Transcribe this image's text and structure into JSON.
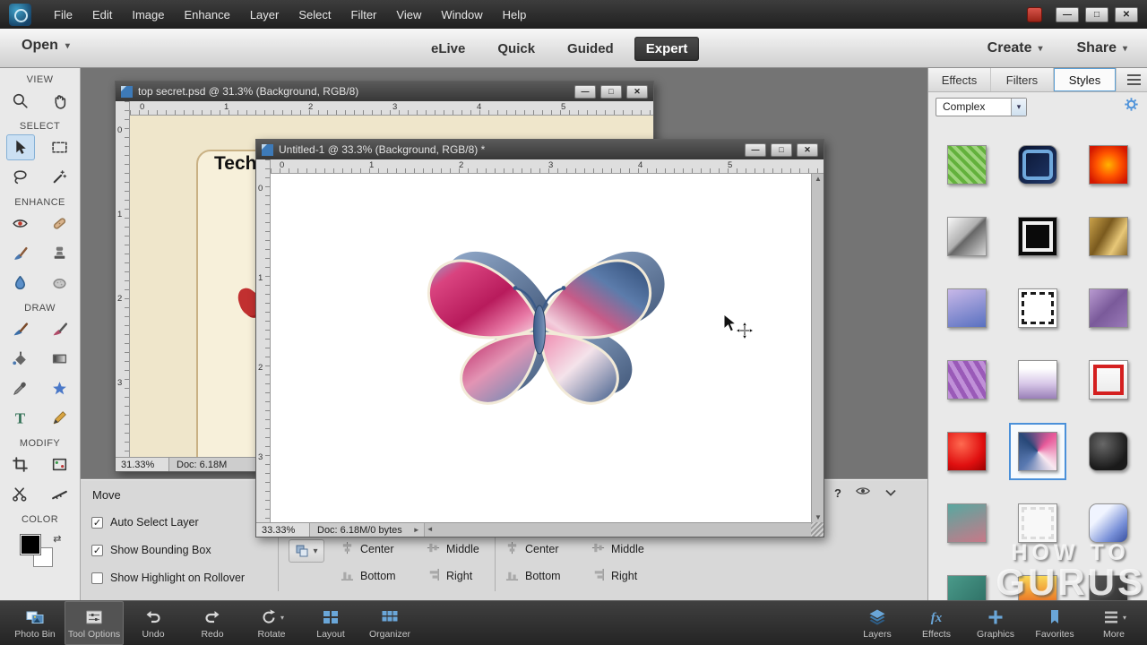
{
  "app": {
    "window_buttons": [
      {
        "name": "minimize",
        "glyph": "—"
      },
      {
        "name": "maximize",
        "glyph": "□"
      },
      {
        "name": "close",
        "glyph": "✕"
      }
    ]
  },
  "icons": {
    "caret_down": "▾",
    "check": "✓",
    "swap": "⇄",
    "scroll_up": "▲",
    "scroll_down": "▼",
    "scroll_left": "◄",
    "scroll_right": "►",
    "panel_arrow": "►",
    "help": "?"
  },
  "menubar": {
    "items": [
      "File",
      "Edit",
      "Image",
      "Enhance",
      "Layer",
      "Select",
      "Filter",
      "View",
      "Window",
      "Help"
    ]
  },
  "topbar": {
    "open_label": "Open",
    "mode_tabs": [
      {
        "label": "eLive"
      },
      {
        "label": "Quick"
      },
      {
        "label": "Guided"
      },
      {
        "label": "Expert",
        "active": true
      }
    ],
    "create_label": "Create",
    "share_label": "Share"
  },
  "tool_sidebar": {
    "sections": [
      {
        "label": "VIEW",
        "tools": [
          {
            "name": "zoom"
          },
          {
            "name": "hand"
          }
        ]
      },
      {
        "label": "SELECT",
        "tools": [
          {
            "name": "move",
            "selected": true
          },
          {
            "name": "marquee"
          },
          {
            "name": "lasso"
          },
          {
            "name": "magic-wand"
          }
        ]
      },
      {
        "label": "ENHANCE",
        "tools": [
          {
            "name": "red-eye"
          },
          {
            "name": "spot-heal"
          },
          {
            "name": "smart-brush"
          },
          {
            "name": "clone-stamp"
          },
          {
            "name": "blur"
          },
          {
            "name": "sponge"
          }
        ]
      },
      {
        "label": "DRAW",
        "tools": [
          {
            "name": "brush"
          },
          {
            "name": "impressionist-brush"
          },
          {
            "name": "paint-bucket"
          },
          {
            "name": "gradient"
          },
          {
            "name": "eyedropper"
          },
          {
            "name": "shape"
          },
          {
            "name": "type"
          },
          {
            "name": "pencil"
          }
        ]
      },
      {
        "label": "MODIFY",
        "tools": [
          {
            "name": "crop"
          },
          {
            "name": "recompose"
          },
          {
            "name": "content-aware-move"
          },
          {
            "name": "straighten"
          }
        ]
      },
      {
        "label": "COLOR",
        "tools": []
      }
    ]
  },
  "documents": [
    {
      "title": "top secret.psd @ 31.3% (Background, RGB/8)",
      "zoom": "31.33%",
      "size": "Doc: 6.18M",
      "content_text": "Tech",
      "ruler_h": [
        "0",
        "1",
        "2",
        "3",
        "4",
        "5"
      ],
      "ruler_v": [
        "0",
        "1",
        "2",
        "3"
      ]
    },
    {
      "title": "Untitled-1 @ 33.3% (Background, RGB/8) *",
      "zoom": "33.33%",
      "size": "Doc: 6.18M/0 bytes",
      "ruler_h": [
        "0",
        "1",
        "2",
        "3",
        "4",
        "5"
      ],
      "ruler_v": [
        "0",
        "1",
        "2",
        "3"
      ]
    }
  ],
  "tool_options": {
    "title": "Move",
    "help_label": "?",
    "checkboxes": [
      {
        "label": "Auto Select Layer",
        "checked": true
      },
      {
        "label": "Show Bounding Box",
        "checked": true
      },
      {
        "label": "Show Highlight on Rollover",
        "checked": false
      }
    ],
    "align_group": {
      "options": [
        "Center",
        "Middle",
        "Bottom",
        "Right"
      ]
    },
    "distribute_group": {
      "options": [
        "Center",
        "Middle",
        "Bottom",
        "Right"
      ]
    }
  },
  "right_panel": {
    "tabs": [
      {
        "label": "Effects"
      },
      {
        "label": "Filters"
      },
      {
        "label": "Styles",
        "active": true
      }
    ],
    "category_dropdown": "Complex",
    "selected_style_index": 13,
    "styles": [
      {
        "name": "green-pattern",
        "bg": "repeating-linear-gradient(45deg,#9ed47c 0 4px,#63b13c 4px 8px)"
      },
      {
        "name": "blue-metal-frame",
        "bg": "linear-gradient(135deg,#0a1430,#20386a)",
        "frame": "#6fa8dc",
        "rounded": true
      },
      {
        "name": "orange-glow",
        "bg": "radial-gradient(circle,#ffb300 0%,#ff5400 45%,#d41800 85%)"
      },
      {
        "name": "silver-diagonal",
        "bg": "linear-gradient(135deg,#f8f8f8 0%,#b0b0b0 45%,#666666 52%,#d8d8d8 100%)"
      },
      {
        "name": "black-frame",
        "bg": "#0a0a0a",
        "frame": "#f0f0f0"
      },
      {
        "name": "bronze-texture",
        "bg": "linear-gradient(120deg,#caa24a,#7a5a1e 40%,#e8c878 70%,#8a6a2e)"
      },
      {
        "name": "purple-blue-gradient",
        "bg": "linear-gradient(160deg,#c8b8e8,#5870c0)"
      },
      {
        "name": "sketch-frame",
        "bg": "#ffffff",
        "frame": "#1a1a1a",
        "sketch": true
      },
      {
        "name": "purple-texture",
        "bg": "linear-gradient(135deg,#b89ad0,#7a5a9a 50%,#9a7ab8)"
      },
      {
        "name": "violet-pattern",
        "bg": "repeating-linear-gradient(60deg,#c090d8 0 5px,#9a5ab8 5px 10px)"
      },
      {
        "name": "white-purple-sheen",
        "bg": "linear-gradient(180deg,#ffffff 20%,#d8c8e8 60%,#9a80b8)"
      },
      {
        "name": "red-frame-glossy",
        "bg": "linear-gradient(180deg,#ffffff,#e8e8e8)",
        "frame": "#d42020"
      },
      {
        "name": "red-glossy",
        "bg": "radial-gradient(circle at 35% 30%,#ff6a50,#e01010 60%,#990000)"
      },
      {
        "name": "pink-blue-quad",
        "bg": "conic-gradient(from 45deg,#e85a9a,#f8e8f0,#5878b0,#284878,#e85a9a)"
      },
      {
        "name": "black-glossy-round",
        "bg": "radial-gradient(circle at 35% 30%,#686868,#1a1a1a 70%)",
        "rounded": true
      },
      {
        "name": "teal-pink-gradient",
        "bg": "linear-gradient(160deg,#58a8a0,#c87888)"
      },
      {
        "name": "white-rough-frame",
        "bg": "#f8f8f8",
        "frame": "#dcdcdc",
        "sketch": true
      },
      {
        "name": "blue-white-glossy",
        "bg": "linear-gradient(135deg,#f0f4ff 30%,#7890d8 70%,#3850a0)",
        "rounded": true
      },
      {
        "name": "teal-texture",
        "bg": "linear-gradient(135deg,#4a9a8a,#2a6a60)"
      },
      {
        "name": "orange-stripes",
        "bg": "linear-gradient(180deg,#f8d858,#f09030 50%,#d84820)"
      },
      {
        "name": "dark-texture",
        "bg": "linear-gradient(135deg,#585858,#282828)"
      }
    ],
    "watermark": {
      "line1": "HOW TO",
      "line2": "GURUS"
    }
  },
  "taskbar": {
    "left": [
      {
        "label": "Photo Bin",
        "icon": "photo-bin"
      },
      {
        "label": "Tool Options",
        "icon": "tool-options",
        "active": true
      },
      {
        "label": "Undo",
        "icon": "undo"
      },
      {
        "label": "Redo",
        "icon": "redo"
      },
      {
        "label": "Rotate",
        "icon": "rotate",
        "caret": true
      },
      {
        "label": "Layout",
        "icon": "layout"
      },
      {
        "label": "Organizer",
        "icon": "organizer"
      }
    ],
    "right": [
      {
        "label": "Layers",
        "icon": "layers"
      },
      {
        "label": "Effects",
        "icon": "fx"
      },
      {
        "label": "Graphics",
        "icon": "graphics"
      },
      {
        "label": "Favorites",
        "icon": "favorites"
      },
      {
        "label": "More",
        "icon": "more",
        "caret": true
      }
    ]
  },
  "colors": {
    "accent_blue": "#4a90d9",
    "taskbar_icon": "#7ab0d8",
    "magenta": "#b81b5c",
    "wing_blue": "#2e4a74"
  }
}
